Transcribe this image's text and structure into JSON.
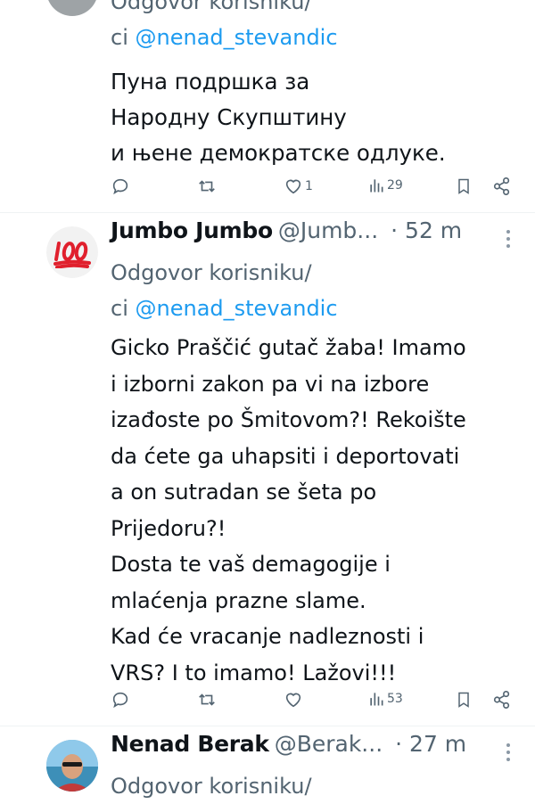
{
  "tweets": [
    {
      "reply_prefix": "Odgovor korisniku/",
      "reply_cont": "ci",
      "mention": "@nenad_stevandic",
      "lines": [
        "Пуна подршка за",
        "Народну Скупштину",
        "и њене демократске одлуке."
      ],
      "likes": "1",
      "views": "29"
    },
    {
      "name": "Jumbo Jumbo",
      "handle": "@Jumb...",
      "time": "· 52 m",
      "reply_prefix": "Odgovor korisniku/",
      "reply_cont": "ci",
      "mention": "@nenad_stevandic",
      "lines": [
        "Gicko Praščić gutač žaba! Imamo",
        "i izborni zakon pa vi na izbore",
        "izađoste po Šmitovom?! Rekoište",
        "da ćete ga uhapsiti i deportovati",
        "a on sutradan se šeta po",
        "Prijedoru?!",
        "Dosta te vaš demagogije i",
        "mlaćenja prazne slame.",
        "Kad će vracanje nadleznosti i",
        "VRS? I to imamo! Lažovi!!!"
      ],
      "views": "53"
    },
    {
      "name": "Nenad Berak",
      "handle": "@Berak...",
      "time": "· 27 m",
      "reply_prefix": "Odgovor korisniku/"
    }
  ],
  "icons": {
    "reply": "reply-icon",
    "retweet": "retweet-icon",
    "like": "like-icon",
    "views": "views-icon",
    "bookmark": "bookmark-icon",
    "share": "share-icon",
    "more": "more-icon"
  },
  "colors": {
    "link": "#1d9bf0",
    "muted": "#536471",
    "text": "#0f1419",
    "emoji_red": "#e0202d"
  }
}
